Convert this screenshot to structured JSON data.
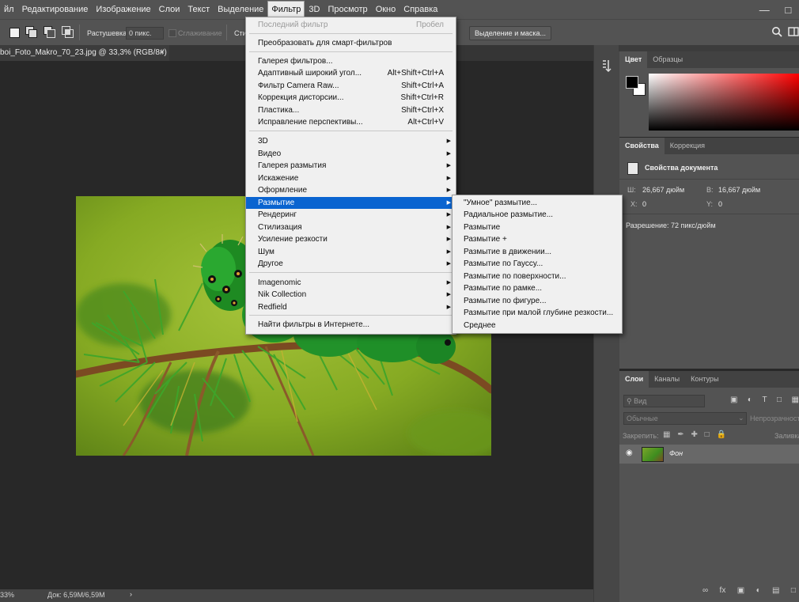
{
  "menubar": {
    "items": [
      "йл",
      "Редактирование",
      "Изображение",
      "Слои",
      "Текст",
      "Выделение",
      "Фильтр",
      "3D",
      "Просмотр",
      "Окно",
      "Справка"
    ],
    "active_index": 6
  },
  "options": {
    "feather_label": "Растушевка:",
    "feather_value": "0 пикс.",
    "antialias_label": "Сглаживание",
    "style_label": "Сти",
    "select_mask_button": "Выделение и маска..."
  },
  "document": {
    "tab_title": "boi_Foto_Makro_70_23.jpg @ 33,3% (RGB/8#)",
    "tab_close": "×",
    "zoom": "33%",
    "doc_size": "Док: 6,59M/6,59M"
  },
  "filter_menu": {
    "last_filter": "Последний фильтр",
    "last_filter_shortcut": "Пробел",
    "convert_smart": "Преобразовать для смарт-фильтров",
    "items_group1": [
      {
        "label": "Галерея фильтров...",
        "shortcut": ""
      },
      {
        "label": "Адаптивный широкий угол...",
        "shortcut": "Alt+Shift+Ctrl+A"
      },
      {
        "label": "Фильтр Camera Raw...",
        "shortcut": "Shift+Ctrl+A"
      },
      {
        "label": "Коррекция дисторсии...",
        "shortcut": "Shift+Ctrl+R"
      },
      {
        "label": "Пластика...",
        "shortcut": "Shift+Ctrl+X"
      },
      {
        "label": "Исправление перспективы...",
        "shortcut": "Alt+Ctrl+V"
      }
    ],
    "items_group2": [
      "3D",
      "Видео",
      "Галерея размытия",
      "Искажение",
      "Оформление",
      "Размытие",
      "Рендеринг",
      "Стилизация",
      "Усиление резкости",
      "Шум",
      "Другое"
    ],
    "highlighted_item": "Размытие",
    "items_group3": [
      "Imagenomic",
      "Nik Collection",
      "Redfield"
    ],
    "browse_online": "Найти фильтры в Интернете..."
  },
  "blur_submenu": {
    "items": [
      "\"Умное\" размытие...",
      "Радиальное размытие...",
      "Размытие",
      "Размытие +",
      "Размытие в движении...",
      "Размытие по Гауссу...",
      "Размытие по поверхности...",
      "Размытие по рамке...",
      "Размытие по фигуре...",
      "Размытие при малой глубине резкости...",
      "Среднее"
    ]
  },
  "color_panel": {
    "tabs": [
      "Цвет",
      "Образцы"
    ],
    "foreground": "#000000",
    "background": "#ffffff",
    "hue_color": "#ff0000"
  },
  "properties_panel": {
    "tabs": [
      "Свойства",
      "Коррекция"
    ],
    "title": "Свойства документа",
    "w_label": "Ш:",
    "w_value": "26,667 дюйм",
    "h_label": "В:",
    "h_value": "16,667 дюйм",
    "x_label": "X:",
    "x_value": "0",
    "y_label": "Y:",
    "y_value": "0",
    "resolution": "Разрешение: 72 пикс/дюйм"
  },
  "layers_panel": {
    "tabs": [
      "Слои",
      "Каналы",
      "Контуры"
    ],
    "kind_placeholder": "Вид",
    "blend_mode": "Обычные",
    "opacity_label": "Непрозрачность",
    "lock_label": "Закрепить:",
    "fill_label": "Заливка",
    "layers": [
      {
        "name": "Фон"
      }
    ]
  },
  "icons": {
    "search": "search-icon",
    "workspace": "workspace-icon",
    "eye": "eye-icon"
  }
}
